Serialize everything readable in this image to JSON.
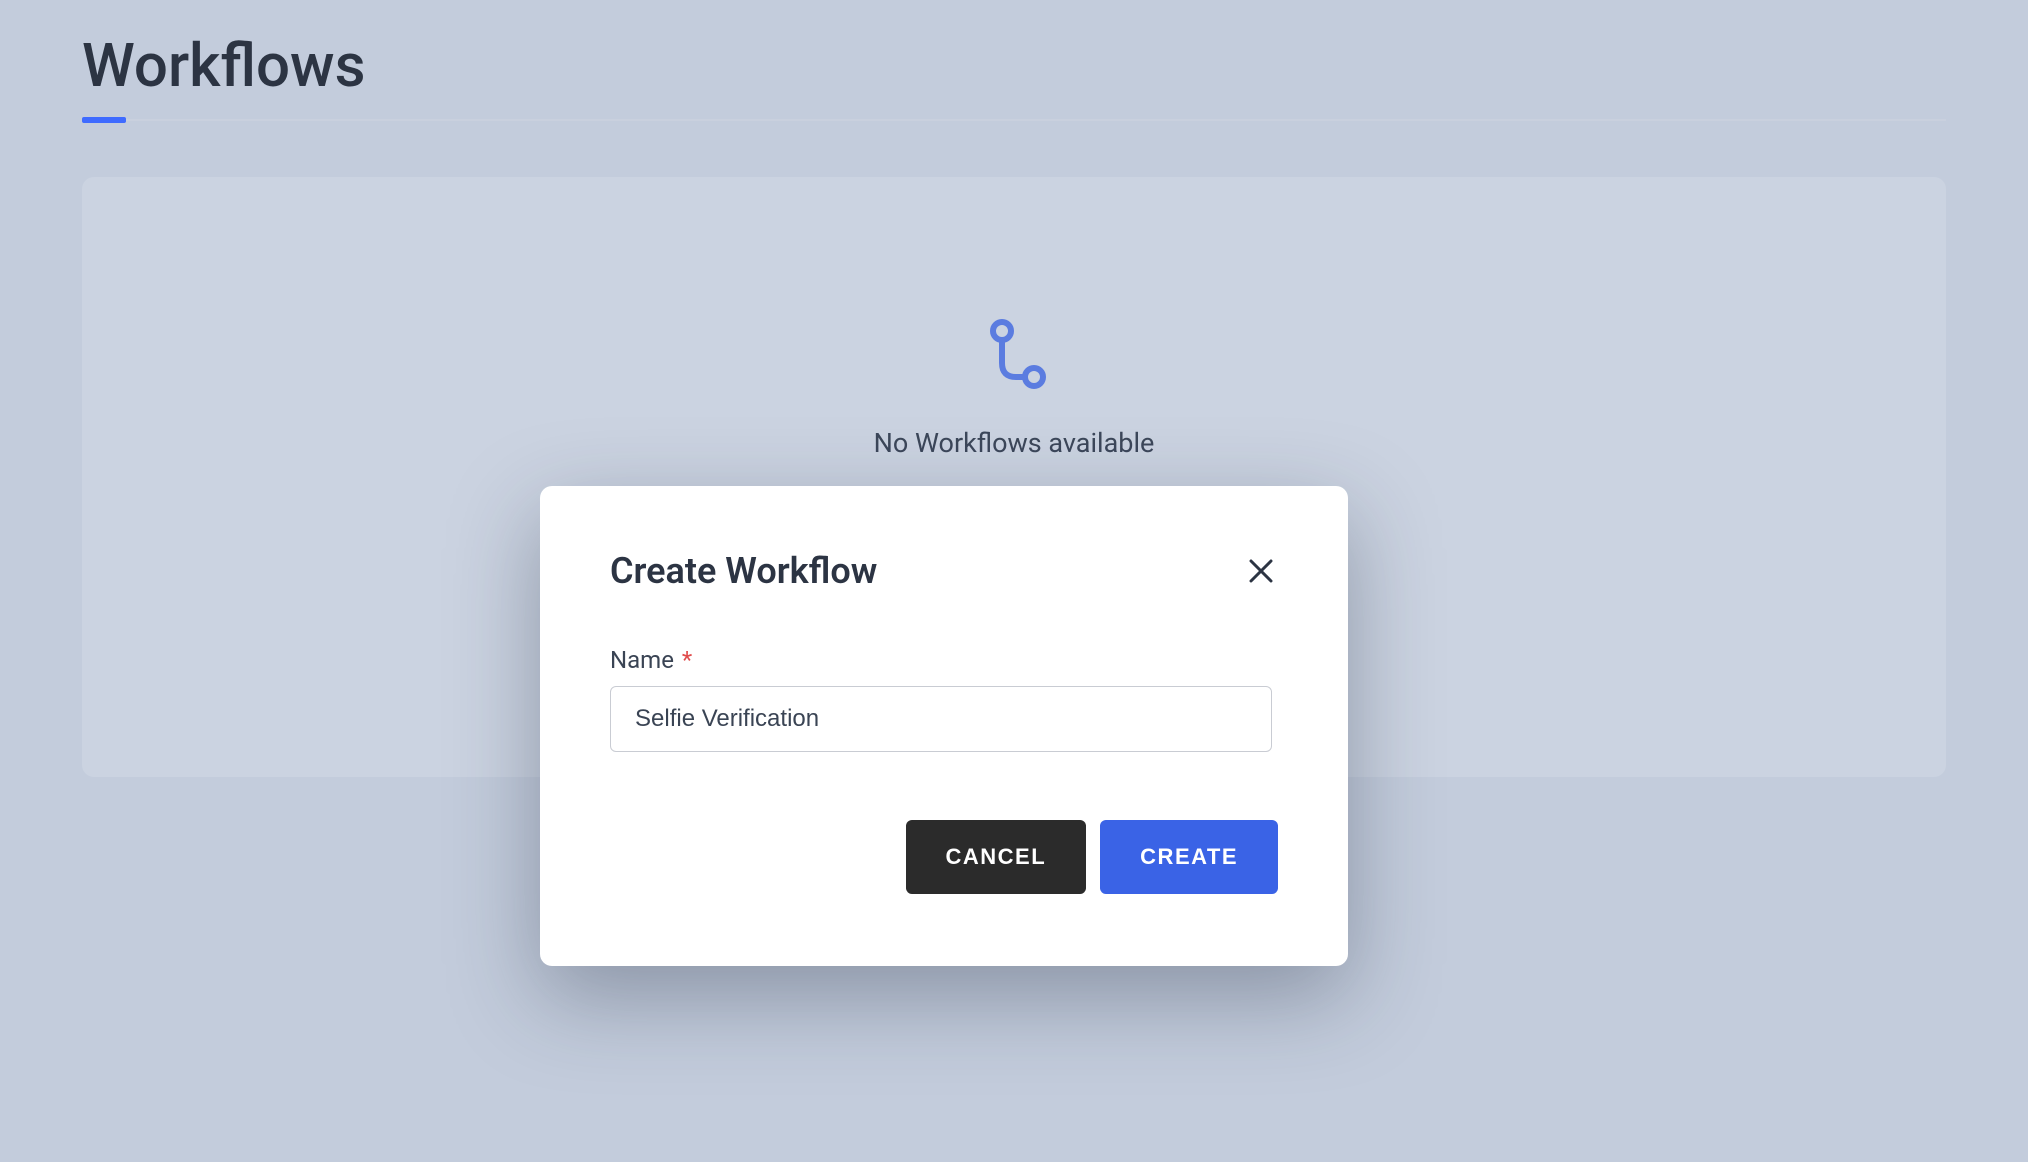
{
  "page": {
    "title": "Workflows",
    "empty_state": {
      "message": "No Workflows available"
    }
  },
  "dialog": {
    "title": "Create Workflow",
    "name_field": {
      "label": "Name",
      "required_marker": "*",
      "value": "Selfie Verification"
    },
    "actions": {
      "cancel_label": "CANCEL",
      "create_label": "CREATE"
    }
  },
  "colors": {
    "accent": "#3a63e6",
    "page_bg": "#c3ccdc",
    "card_bg": "#cbd3e1"
  }
}
